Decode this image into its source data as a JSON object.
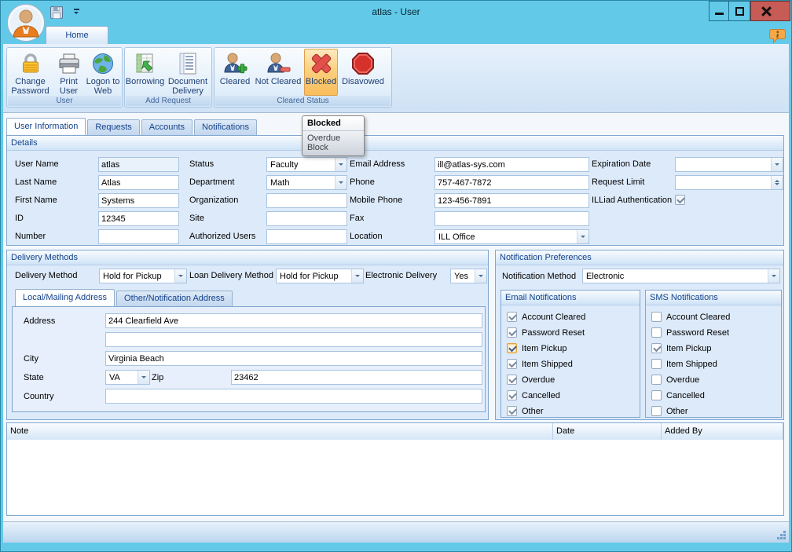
{
  "window": {
    "title": "atlas - User",
    "controls": {
      "minimize": "minimize-icon",
      "maximize": "maximize-icon",
      "close": "close-icon"
    },
    "quick_access": {
      "app_button": "avatar-icon",
      "save": "save-icon",
      "customize": "chevron-down-icon"
    },
    "help": "help-icon"
  },
  "ribbon": {
    "home_tab": "Home",
    "groups": [
      {
        "label": "User",
        "buttons": [
          {
            "label": "Change Password",
            "icon": "lock-icon",
            "selected": false
          },
          {
            "label": "Print User",
            "icon": "printer-icon",
            "selected": false
          },
          {
            "label": "Logon to Web",
            "icon": "globe-icon",
            "selected": false
          }
        ]
      },
      {
        "label": "Add Request",
        "buttons": [
          {
            "label": "Borrowing",
            "icon": "spreadsheet-arrow-icon",
            "selected": false
          },
          {
            "label": "Document Delivery",
            "icon": "document-grid-icon",
            "selected": false
          }
        ]
      },
      {
        "label": "Cleared Status",
        "buttons": [
          {
            "label": "Cleared",
            "icon": "user-add-icon",
            "selected": false
          },
          {
            "label": "Not Cleared",
            "icon": "user-remove-icon",
            "selected": false
          },
          {
            "label": "Blocked",
            "icon": "block-x-icon",
            "selected": true
          },
          {
            "label": "Disavowed",
            "icon": "stop-sign-icon",
            "selected": false
          }
        ]
      }
    ]
  },
  "tooltip": {
    "title": "Blocked",
    "subtitle": "Overdue Block"
  },
  "main_tabs": [
    "User Information",
    "Requests",
    "Accounts",
    "Notifications"
  ],
  "details": {
    "header": "Details",
    "rows": [
      [
        {
          "name": "user-name",
          "label": "User Name",
          "type": "text",
          "value": "atlas",
          "disabled": true
        },
        {
          "name": "status",
          "label": "Status",
          "type": "combo",
          "value": "Faculty"
        },
        {
          "name": "email-address",
          "label": "Email Address",
          "type": "text",
          "value": "ill@atlas-sys.com"
        },
        {
          "name": "expiration-date",
          "label": "Expiration Date",
          "type": "combo",
          "value": ""
        }
      ],
      [
        {
          "name": "last-name",
          "label": "Last Name",
          "type": "text",
          "value": "Atlas"
        },
        {
          "name": "department",
          "label": "Department",
          "type": "combo",
          "value": "Math"
        },
        {
          "name": "phone",
          "label": "Phone",
          "type": "text",
          "value": "757-467-7872"
        },
        {
          "name": "request-limit",
          "label": "Request Limit",
          "type": "spin",
          "value": ""
        }
      ],
      [
        {
          "name": "first-name",
          "label": "First Name",
          "type": "text",
          "value": "Systems"
        },
        {
          "name": "organization",
          "label": "Organization",
          "type": "text",
          "value": ""
        },
        {
          "name": "mobile-phone",
          "label": "Mobile Phone",
          "type": "text",
          "value": "123-456-7891"
        },
        {
          "name": "illiad-authentication",
          "label": "ILLiad Authentication",
          "type": "check",
          "checked": true
        }
      ],
      [
        {
          "name": "id",
          "label": "ID",
          "type": "text",
          "value": "12345"
        },
        {
          "name": "site",
          "label": "Site",
          "type": "text",
          "value": ""
        },
        {
          "name": "fax",
          "label": "Fax",
          "type": "text",
          "value": ""
        },
        null
      ],
      [
        {
          "name": "number",
          "label": "Number",
          "type": "text",
          "value": ""
        },
        {
          "name": "authorized-users",
          "label": "Authorized Users",
          "type": "text",
          "value": ""
        },
        {
          "name": "location",
          "label": "Location",
          "type": "combo",
          "value": "ILL Office"
        },
        null
      ]
    ]
  },
  "delivery": {
    "header": "Delivery Methods",
    "fields": [
      {
        "name": "delivery-method",
        "label": "Delivery Method",
        "value": "Hold for Pickup"
      },
      {
        "name": "loan-delivery-method",
        "label": "Loan Delivery Method",
        "value": "Hold for Pickup"
      },
      {
        "name": "electronic-delivery",
        "label": "Electronic Delivery",
        "value": "Yes"
      }
    ]
  },
  "address": {
    "tabs": [
      "Local/Mailing Address",
      "Other/Notification Address"
    ],
    "active_tab": 0,
    "fields": {
      "address1": {
        "label": "Address",
        "value": "244 Clearfield Ave"
      },
      "address2": {
        "label": "",
        "value": ""
      },
      "city": {
        "label": "City",
        "value": "Virginia Beach"
      },
      "state": {
        "label": "State",
        "value": "VA"
      },
      "zip": {
        "label": "Zip",
        "value": "23462"
      },
      "country": {
        "label": "Country",
        "value": ""
      }
    }
  },
  "notifications": {
    "header": "Notification Preferences",
    "method": {
      "label": "Notification Method",
      "value": "Electronic"
    },
    "email": {
      "header": "Email Notifications",
      "items": [
        {
          "label": "Account Cleared",
          "checked": true,
          "focused": false
        },
        {
          "label": "Password Reset",
          "checked": true,
          "focused": false
        },
        {
          "label": "Item Pickup",
          "checked": true,
          "focused": true
        },
        {
          "label": "Item Shipped",
          "checked": true,
          "focused": false
        },
        {
          "label": "Overdue",
          "checked": true,
          "focused": false
        },
        {
          "label": "Cancelled",
          "checked": true,
          "focused": false
        },
        {
          "label": "Other",
          "checked": true,
          "focused": false
        }
      ]
    },
    "sms": {
      "header": "SMS Notifications",
      "items": [
        {
          "label": "Account Cleared",
          "checked": false,
          "focused": false
        },
        {
          "label": "Password Reset",
          "checked": false,
          "focused": false
        },
        {
          "label": "Item Pickup",
          "checked": true,
          "focused": false
        },
        {
          "label": "Item Shipped",
          "checked": false,
          "focused": false
        },
        {
          "label": "Overdue",
          "checked": false,
          "focused": false
        },
        {
          "label": "Cancelled",
          "checked": false,
          "focused": false
        },
        {
          "label": "Other",
          "checked": false,
          "focused": false
        }
      ]
    }
  },
  "notes_table": {
    "columns": [
      "Note",
      "Date",
      "Added By"
    ],
    "rows": []
  }
}
